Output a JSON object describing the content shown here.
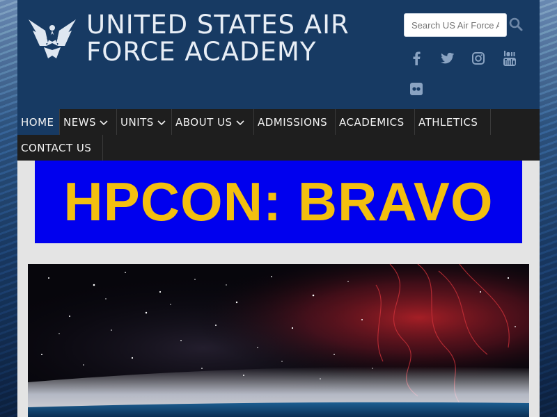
{
  "header": {
    "title": "UNITED STATES AIR FORCE ACADEMY",
    "logo_icon": "air-force-wings-logo",
    "background": "#173a63"
  },
  "search": {
    "placeholder": "Search US Air Force Academy",
    "icon": "search-icon"
  },
  "social": [
    "facebook-icon",
    "twitter-icon",
    "instagram-icon",
    "youtube-icon",
    "flickr-icon"
  ],
  "nav": {
    "items": [
      {
        "label": "HOME",
        "active": true,
        "dropdown": false
      },
      {
        "label": "NEWS",
        "active": false,
        "dropdown": true
      },
      {
        "label": "UNITS",
        "active": false,
        "dropdown": true
      },
      {
        "label": "ABOUT US",
        "active": false,
        "dropdown": true
      },
      {
        "label": "ADMISSIONS",
        "active": false,
        "dropdown": false
      },
      {
        "label": "ACADEMICS",
        "active": false,
        "dropdown": false
      },
      {
        "label": "ATHLETICS",
        "active": false,
        "dropdown": false
      },
      {
        "label": "CONTACT US",
        "active": false,
        "dropdown": false
      }
    ],
    "background": "#1e1e1e",
    "active_color": "#173a63"
  },
  "banner": {
    "text": "HPCON: BRAVO",
    "background": "#0000ee",
    "text_color": "#f3bf0f"
  },
  "hero": {
    "image": "space-earth-horizon-nebula"
  }
}
